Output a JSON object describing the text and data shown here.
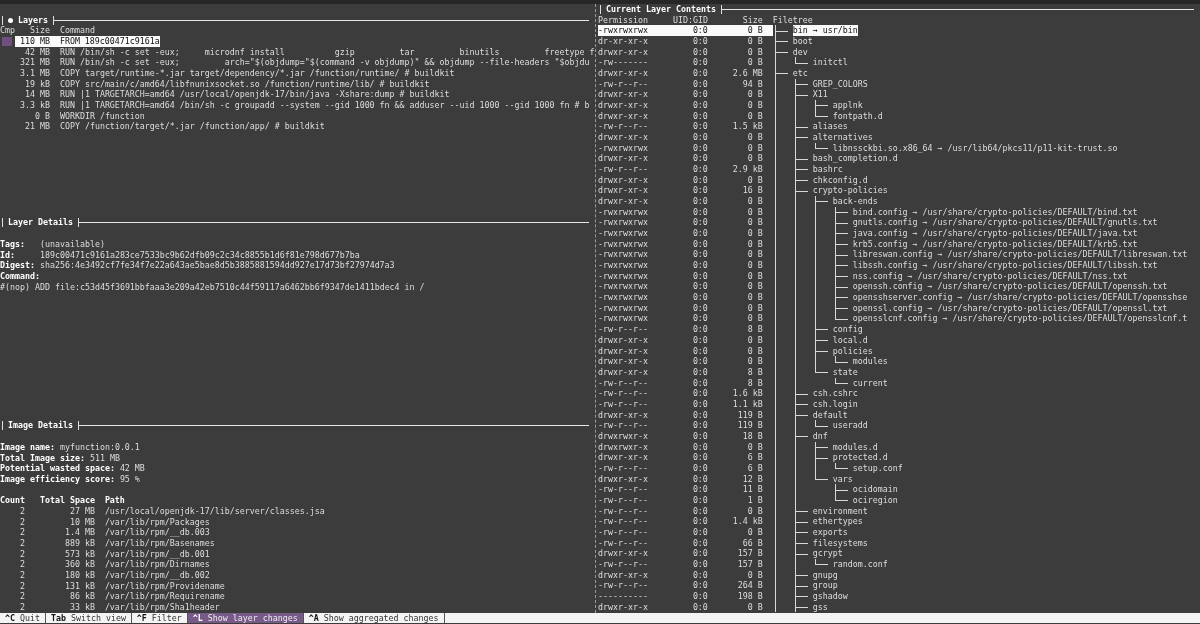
{
  "layers": {
    "title": "Layers",
    "focused": true,
    "columns": [
      "Cmp",
      "Size",
      "Command"
    ],
    "rows": [
      {
        "size": "110 MB",
        "command": "FROM 189c00471c9161a",
        "selected": true
      },
      {
        "size": "42 MB",
        "command": "RUN /bin/sh -c set -eux;     microdnf install          gzip         tar         binutils         freetype f",
        "selected": false
      },
      {
        "size": "321 MB",
        "command": "RUN /bin/sh -c set -eux;         arch=\"$(objdump=\"$(command -v objdump)\" && objdump --file-headers \"$objdu",
        "selected": false
      },
      {
        "size": "3.1 MB",
        "command": "COPY target/runtime-*.jar target/dependency/*.jar /function/runtime/ # buildkit",
        "selected": false
      },
      {
        "size": "19 kB",
        "command": "COPY src/main/c/amd64/libfnunixsocket.so /function/runtime/lib/ # buildkit",
        "selected": false
      },
      {
        "size": "14 MB",
        "command": "RUN |1 TARGETARCH=amd64 /usr/local/openjdk-17/bin/java -Xshare:dump # buildkit",
        "selected": false
      },
      {
        "size": "3.3 kB",
        "command": "RUN |1 TARGETARCH=amd64 /bin/sh -c groupadd --system --gid 1000 fn && adduser --uid 1000 --gid 1000 fn # b",
        "selected": false
      },
      {
        "size": "0 B",
        "command": "WORKDIR /function",
        "selected": false
      },
      {
        "size": "21 MB",
        "command": "COPY /function/target/*.jar /function/app/ # buildkit",
        "selected": false
      }
    ]
  },
  "layer_details": {
    "title": "Layer Details",
    "focused": false,
    "fields": [
      {
        "label": "Tags:",
        "value": "(unavailable)"
      },
      {
        "label": "Id:",
        "value": "189c00471c9161a283ce7533bc9b62dfb09c2c34c8855b1d6f81e798d677b7ba"
      },
      {
        "label": "Digest:",
        "value": "sha256:4e3492cf7fe34f7e22a643ae5bae8d5b3885881594dd927e17d73bf27974d7a3"
      }
    ],
    "command_label": "Command:",
    "command": "#(nop) ADD file:c53d45f3691bbfaaa3e209a42eb7510c44f59117a6462bb6f9347de1411bdec4 in /"
  },
  "image_details": {
    "title": "Image Details",
    "focused": false,
    "fields": [
      {
        "label": "Image name:",
        "value": "myfunction:0.0.1"
      },
      {
        "label": "Total Image size:",
        "value": "511 MB"
      },
      {
        "label": "Potential wasted space:",
        "value": "42 MB"
      },
      {
        "label": "Image efficiency score:",
        "value": "95 %"
      }
    ],
    "columns": [
      "Count",
      "Total Space",
      "Path"
    ],
    "rows": [
      {
        "count": "2",
        "total_space": "27 MB",
        "path": "/usr/local/openjdk-17/lib/server/classes.jsa"
      },
      {
        "count": "2",
        "total_space": "10 MB",
        "path": "/var/lib/rpm/Packages"
      },
      {
        "count": "2",
        "total_space": "1.4 MB",
        "path": "/var/lib/rpm/__db.003"
      },
      {
        "count": "2",
        "total_space": "889 kB",
        "path": "/var/lib/rpm/Basenames"
      },
      {
        "count": "2",
        "total_space": "573 kB",
        "path": "/var/lib/rpm/__db.001"
      },
      {
        "count": "2",
        "total_space": "360 kB",
        "path": "/var/lib/rpm/Dirnames"
      },
      {
        "count": "2",
        "total_space": "180 kB",
        "path": "/var/lib/rpm/__db.002"
      },
      {
        "count": "2",
        "total_space": "131 kB",
        "path": "/var/lib/rpm/Providename"
      },
      {
        "count": "2",
        "total_space": "86 kB",
        "path": "/var/lib/rpm/Requirename"
      },
      {
        "count": "2",
        "total_space": "33 kB",
        "path": "/var/lib/rpm/Sha1header"
      }
    ]
  },
  "contents": {
    "title": "Current Layer Contents",
    "focused": false,
    "columns": [
      "Permission",
      "UID:GID",
      "Size",
      "Filetree"
    ],
    "tree_continues": true,
    "tree": [
      {
        "name": "bin → usr/bin",
        "permission": "-rwxrwxrwx",
        "uid_gid": "0:0",
        "size": "0 B",
        "selected": true
      },
      {
        "name": "boot",
        "permission": "dr-xr-xr-x",
        "uid_gid": "0:0",
        "size": "0 B",
        "selected": false
      },
      {
        "name": "dev",
        "permission": "drwxr-xr-x",
        "uid_gid": "0:0",
        "size": "0 B",
        "selected": false,
        "children": [
          {
            "name": "initctl",
            "permission": "-rw-------",
            "uid_gid": "0:0",
            "size": "0 B",
            "selected": false
          }
        ]
      },
      {
        "name": "etc",
        "permission": "drwxr-xr-x",
        "uid_gid": "0:0",
        "size": "2.6 MB",
        "selected": false,
        "children": [
          {
            "name": "GREP_COLORS",
            "permission": "-rw-r--r--",
            "uid_gid": "0:0",
            "size": "94 B",
            "selected": false
          },
          {
            "name": "X11",
            "permission": "drwxr-xr-x",
            "uid_gid": "0:0",
            "size": "0 B",
            "selected": false,
            "children": [
              {
                "name": "applnk",
                "permission": "drwxr-xr-x",
                "uid_gid": "0:0",
                "size": "0 B",
                "selected": false
              },
              {
                "name": "fontpath.d",
                "permission": "drwxr-xr-x",
                "uid_gid": "0:0",
                "size": "0 B",
                "selected": false
              }
            ]
          },
          {
            "name": "aliases",
            "permission": "-rw-r--r--",
            "uid_gid": "0:0",
            "size": "1.5 kB",
            "selected": false
          },
          {
            "name": "alternatives",
            "permission": "drwxr-xr-x",
            "uid_gid": "0:0",
            "size": "0 B",
            "selected": false,
            "children": [
              {
                "name": "libnssckbi.so.x86_64 → /usr/lib64/pkcs11/p11-kit-trust.so",
                "permission": "-rwxrwxrwx",
                "uid_gid": "0:0",
                "size": "0 B",
                "selected": false
              }
            ]
          },
          {
            "name": "bash_completion.d",
            "permission": "drwxr-xr-x",
            "uid_gid": "0:0",
            "size": "0 B",
            "selected": false
          },
          {
            "name": "bashrc",
            "permission": "-rw-r--r--",
            "uid_gid": "0:0",
            "size": "2.9 kB",
            "selected": false
          },
          {
            "name": "chkconfig.d",
            "permission": "drwxr-xr-x",
            "uid_gid": "0:0",
            "size": "0 B",
            "selected": false
          },
          {
            "name": "crypto-policies",
            "permission": "drwxr-xr-x",
            "uid_gid": "0:0",
            "size": "16 B",
            "selected": false,
            "children": [
              {
                "name": "back-ends",
                "permission": "drwxr-xr-x",
                "uid_gid": "0:0",
                "size": "0 B",
                "selected": false,
                "children": [
                  {
                    "name": "bind.config → /usr/share/crypto-policies/DEFAULT/bind.txt",
                    "permission": "-rwxrwxrwx",
                    "uid_gid": "0:0",
                    "size": "0 B",
                    "selected": false
                  },
                  {
                    "name": "gnutls.config → /usr/share/crypto-policies/DEFAULT/gnutls.txt",
                    "permission": "-rwxrwxrwx",
                    "uid_gid": "0:0",
                    "size": "0 B",
                    "selected": false
                  },
                  {
                    "name": "java.config → /usr/share/crypto-policies/DEFAULT/java.txt",
                    "permission": "-rwxrwxrwx",
                    "uid_gid": "0:0",
                    "size": "0 B",
                    "selected": false
                  },
                  {
                    "name": "krb5.config → /usr/share/crypto-policies/DEFAULT/krb5.txt",
                    "permission": "-rwxrwxrwx",
                    "uid_gid": "0:0",
                    "size": "0 B",
                    "selected": false
                  },
                  {
                    "name": "libreswan.config → /usr/share/crypto-policies/DEFAULT/libreswan.txt",
                    "permission": "-rwxrwxrwx",
                    "uid_gid": "0:0",
                    "size": "0 B",
                    "selected": false
                  },
                  {
                    "name": "libssh.config → /usr/share/crypto-policies/DEFAULT/libssh.txt",
                    "permission": "-rwxrwxrwx",
                    "uid_gid": "0:0",
                    "size": "0 B",
                    "selected": false
                  },
                  {
                    "name": "nss.config → /usr/share/crypto-policies/DEFAULT/nss.txt",
                    "permission": "-rwxrwxrwx",
                    "uid_gid": "0:0",
                    "size": "0 B",
                    "selected": false
                  },
                  {
                    "name": "openssh.config → /usr/share/crypto-policies/DEFAULT/openssh.txt",
                    "permission": "-rwxrwxrwx",
                    "uid_gid": "0:0",
                    "size": "0 B",
                    "selected": false
                  },
                  {
                    "name": "opensshserver.config → /usr/share/crypto-policies/DEFAULT/opensshse",
                    "permission": "-rwxrwxrwx",
                    "uid_gid": "0:0",
                    "size": "0 B",
                    "selected": false
                  },
                  {
                    "name": "openssl.config → /usr/share/crypto-policies/DEFAULT/openssl.txt",
                    "permission": "-rwxrwxrwx",
                    "uid_gid": "0:0",
                    "size": "0 B",
                    "selected": false
                  },
                  {
                    "name": "opensslcnf.config → /usr/share/crypto-policies/DEFAULT/opensslcnf.t",
                    "permission": "-rwxrwxrwx",
                    "uid_gid": "0:0",
                    "size": "0 B",
                    "selected": false
                  }
                ]
              },
              {
                "name": "config",
                "permission": "-rw-r--r--",
                "uid_gid": "0:0",
                "size": "8 B",
                "selected": false
              },
              {
                "name": "local.d",
                "permission": "drwxr-xr-x",
                "uid_gid": "0:0",
                "size": "0 B",
                "selected": false
              },
              {
                "name": "policies",
                "permission": "drwxr-xr-x",
                "uid_gid": "0:0",
                "size": "0 B",
                "selected": false,
                "children": [
                  {
                    "name": "modules",
                    "permission": "drwxr-xr-x",
                    "uid_gid": "0:0",
                    "size": "0 B",
                    "selected": false
                  }
                ]
              },
              {
                "name": "state",
                "permission": "drwxr-xr-x",
                "uid_gid": "0:0",
                "size": "8 B",
                "selected": false,
                "children": [
                  {
                    "name": "current",
                    "permission": "-rw-r--r--",
                    "uid_gid": "0:0",
                    "size": "8 B",
                    "selected": false
                  }
                ]
              }
            ]
          },
          {
            "name": "csh.cshrc",
            "permission": "-rw-r--r--",
            "uid_gid": "0:0",
            "size": "1.6 kB",
            "selected": false
          },
          {
            "name": "csh.login",
            "permission": "-rw-r--r--",
            "uid_gid": "0:0",
            "size": "1.1 kB",
            "selected": false
          },
          {
            "name": "default",
            "permission": "drwxr-xr-x",
            "uid_gid": "0:0",
            "size": "119 B",
            "selected": false,
            "children": [
              {
                "name": "useradd",
                "permission": "-rw-r--r--",
                "uid_gid": "0:0",
                "size": "119 B",
                "selected": false
              }
            ]
          },
          {
            "name": "dnf",
            "permission": "drwxrwxr-x",
            "uid_gid": "0:0",
            "size": "18 B",
            "selected": false,
            "children": [
              {
                "name": "modules.d",
                "permission": "drwxrwxr-x",
                "uid_gid": "0:0",
                "size": "0 B",
                "selected": false
              },
              {
                "name": "protected.d",
                "permission": "drwxr-xr-x",
                "uid_gid": "0:0",
                "size": "6 B",
                "selected": false,
                "children": [
                  {
                    "name": "setup.conf",
                    "permission": "-rw-r--r--",
                    "uid_gid": "0:0",
                    "size": "6 B",
                    "selected": false
                  }
                ]
              },
              {
                "name": "vars",
                "permission": "drwxr-xr-x",
                "uid_gid": "0:0",
                "size": "12 B",
                "selected": false,
                "children": [
                  {
                    "name": "ocidomain",
                    "permission": "-rw-r--r--",
                    "uid_gid": "0:0",
                    "size": "11 B",
                    "selected": false
                  },
                  {
                    "name": "ociregion",
                    "permission": "-rw-r--r--",
                    "uid_gid": "0:0",
                    "size": "1 B",
                    "selected": false
                  }
                ]
              }
            ]
          },
          {
            "name": "environment",
            "permission": "-rw-r--r--",
            "uid_gid": "0:0",
            "size": "0 B",
            "selected": false
          },
          {
            "name": "ethertypes",
            "permission": "-rw-r--r--",
            "uid_gid": "0:0",
            "size": "1.4 kB",
            "selected": false
          },
          {
            "name": "exports",
            "permission": "-rw-r--r--",
            "uid_gid": "0:0",
            "size": "0 B",
            "selected": false
          },
          {
            "name": "filesystems",
            "permission": "-rw-r--r--",
            "uid_gid": "0:0",
            "size": "66 B",
            "selected": false
          },
          {
            "name": "gcrypt",
            "permission": "drwxr-xr-x",
            "uid_gid": "0:0",
            "size": "157 B",
            "selected": false,
            "children": [
              {
                "name": "random.conf",
                "permission": "-rw-r--r--",
                "uid_gid": "0:0",
                "size": "157 B",
                "selected": false
              }
            ]
          },
          {
            "name": "gnupg",
            "permission": "drwxr-xr-x",
            "uid_gid": "0:0",
            "size": "0 B",
            "selected": false
          },
          {
            "name": "group",
            "permission": "-rw-r--r--",
            "uid_gid": "0:0",
            "size": "264 B",
            "selected": false
          },
          {
            "name": "gshadow",
            "permission": "----------",
            "uid_gid": "0:0",
            "size": "198 B",
            "selected": false
          },
          {
            "name": "gss",
            "permission": "drwxr-xr-x",
            "uid_gid": "0:0",
            "size": "0 B",
            "selected": false
          }
        ]
      }
    ]
  },
  "footer": [
    {
      "key": "^C",
      "label": "Quit",
      "selected": false
    },
    {
      "key": "Tab",
      "label": "Switch view",
      "selected": false
    },
    {
      "key": "^F",
      "label": "Filter",
      "selected": false
    },
    {
      "key": "^L",
      "label": "Show layer changes",
      "selected": true
    },
    {
      "key": "^A",
      "label": "Show aggregated changes",
      "selected": false
    }
  ]
}
